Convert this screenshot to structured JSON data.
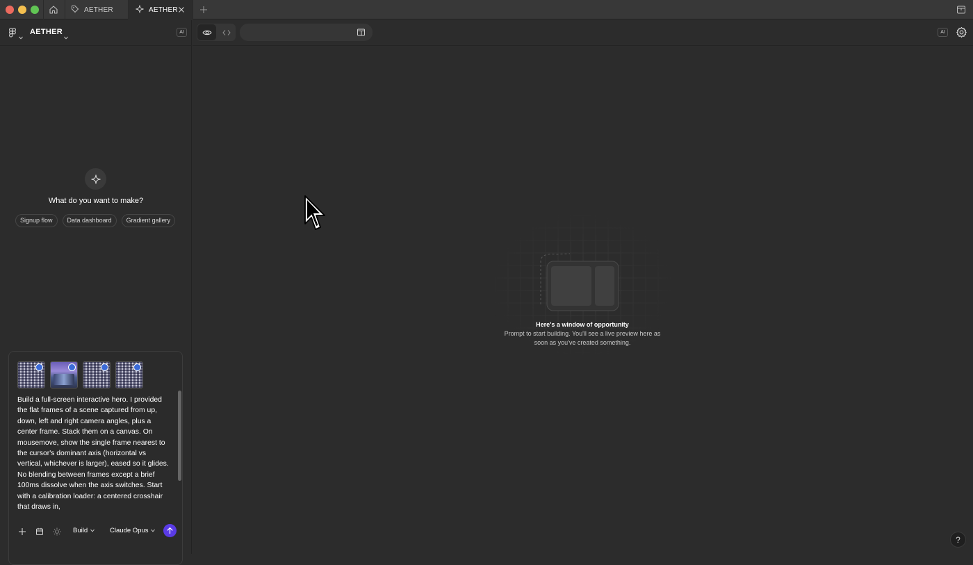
{
  "tabs": [
    {
      "label": "AETHER",
      "icon": "tag-icon",
      "active": false
    },
    {
      "label": "AETHER",
      "icon": "sparkle-icon",
      "active": true
    }
  ],
  "left_panel": {
    "project_title": "AETHER",
    "ai_label": "AI",
    "prompt_heading": "What do you want to make?",
    "suggestions": [
      "Signup flow",
      "Data dashboard",
      "Gradient gallery"
    ]
  },
  "composer": {
    "attachments": [
      "pattern-frame",
      "photo-frame",
      "pattern-frame",
      "pattern-frame"
    ],
    "prompt": "Build a full-screen interactive hero. I provided the flat frames of a scene captured from up, down, left and right camera angles, plus a center frame. Stack them on a canvas. On mousemove, show the single frame nearest to the cursor's dominant axis (horizontal vs vertical, whichever is larger), eased so it glides. No blending between frames except a brief 100ms dissolve when the axis switches. Start with a calibration loader: a centered crosshair that draws in,",
    "mode": "Build",
    "model": "Claude Opus"
  },
  "toolbar": {
    "url_value": "",
    "ai_label": "AI"
  },
  "empty_state": {
    "title": "Here's a window of opportunity",
    "description": "Prompt to start building. You'll see a live preview here as soon as you've created something."
  },
  "help": "?",
  "colors": {
    "accent": "#5a3be6",
    "background": "#2c2c2c",
    "tabbar": "#383838"
  }
}
